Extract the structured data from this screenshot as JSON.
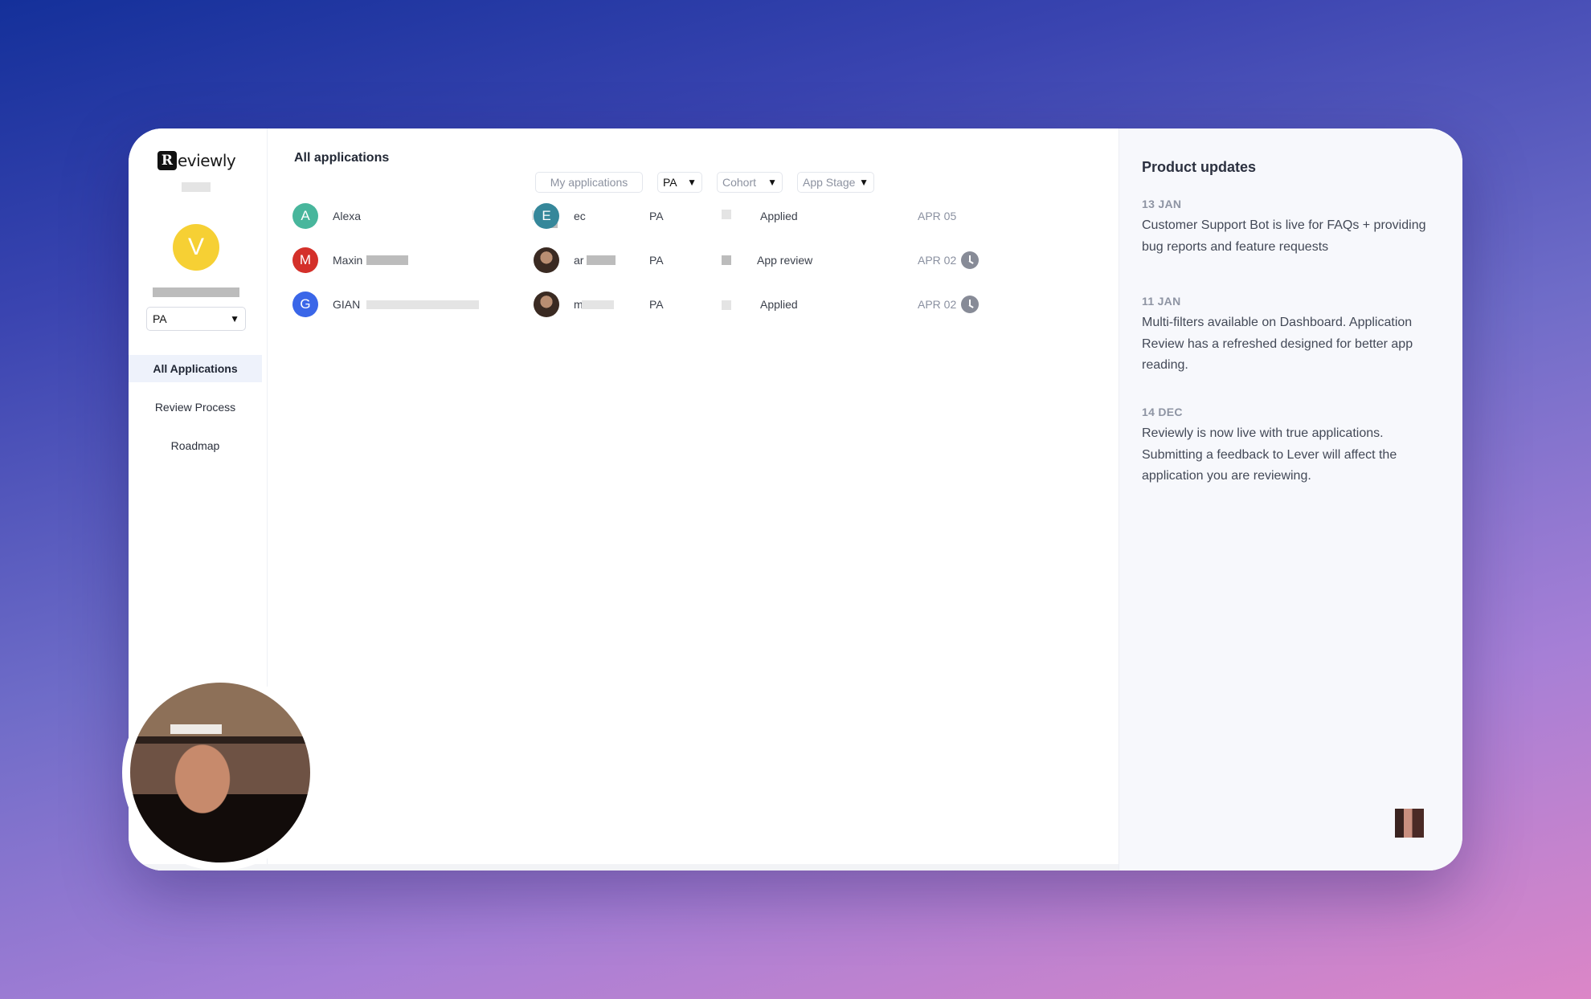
{
  "app": {
    "logo_mark": "R",
    "logo_text": "eviewly"
  },
  "sidebar": {
    "avatar_initial": "V",
    "program_select": "PA",
    "nav": [
      {
        "label": "All Applications"
      },
      {
        "label": "Review Process"
      },
      {
        "label": "Roadmap"
      }
    ]
  },
  "main": {
    "title": "All applications",
    "filters": {
      "my_applications": "My applications",
      "program": "PA",
      "cohort": "Cohort",
      "app_stage": "App Stage"
    },
    "rows": [
      {
        "initial": "A",
        "avatar_color": "#48b69c",
        "applicant": "Alexa",
        "reviewer_initial": "E",
        "reviewer_color": "#35879a",
        "reviewer": "ec",
        "program": "PA",
        "stage": "Applied",
        "date": "APR 05",
        "pending": false
      },
      {
        "initial": "M",
        "avatar_color": "#d4302a",
        "applicant": "Maxin",
        "reviewer_initial": "",
        "reviewer_color": "",
        "reviewer": "ar",
        "program": "PA",
        "stage": "App review",
        "date": "APR 02",
        "pending": true
      },
      {
        "initial": "G",
        "avatar_color": "#3a66e8",
        "applicant": "GIAN",
        "reviewer_initial": "",
        "reviewer_color": "",
        "reviewer": "m",
        "program": "PA",
        "stage": "Applied",
        "date": "APR 02",
        "pending": true
      }
    ]
  },
  "updates": {
    "title": "Product updates",
    "items": [
      {
        "date": "13 JAN",
        "text": "Customer Support Bot is live for FAQs + providing bug reports and feature requests"
      },
      {
        "date": "11 JAN",
        "text": "Multi-filters available on Dashboard. Application Review has a refreshed designed for better app reading."
      },
      {
        "date": "14 DEC",
        "text": "Reviewly is now live with true applications. Submitting a feedback to Lever will affect the application you are reviewing."
      }
    ]
  },
  "icons": {
    "pending": "clock-icon",
    "dropdown": "chevron-down-icon"
  }
}
